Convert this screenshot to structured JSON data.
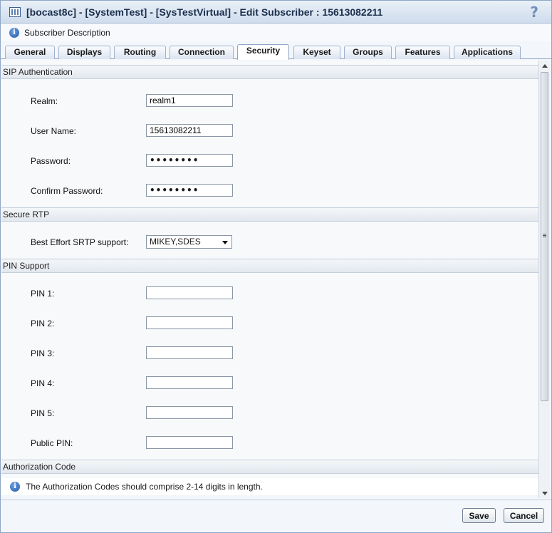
{
  "window": {
    "title": "[bocast8c] - [SystemTest] - [SysTestVirtual] - Edit Subscriber : 15613082211",
    "help_icon": "help-icon"
  },
  "description_bar": {
    "label": "Subscriber Description",
    "icon": "info-icon"
  },
  "tabs": [
    {
      "label": "General",
      "active": false
    },
    {
      "label": "Displays",
      "active": false
    },
    {
      "label": "Routing",
      "active": false
    },
    {
      "label": "Connection",
      "active": false
    },
    {
      "label": "Security",
      "active": true
    },
    {
      "label": "Keyset",
      "active": false
    },
    {
      "label": "Groups",
      "active": false
    },
    {
      "label": "Features",
      "active": false
    },
    {
      "label": "Applications",
      "active": false
    }
  ],
  "sip_auth": {
    "header": "SIP Authentication",
    "realm_label": "Realm:",
    "realm_value": "realm1",
    "username_label": "User Name:",
    "username_value": "15613082211",
    "password_label": "Password:",
    "password_masked": "••••••••",
    "confirm_label": "Confirm Password:",
    "confirm_masked": "••••••••"
  },
  "secure_rtp": {
    "header": "Secure RTP",
    "srtp_label": "Best Effort SRTP support:",
    "srtp_value": "MIKEY,SDES"
  },
  "pin_support": {
    "header": "PIN Support",
    "pin1_label": "PIN 1:",
    "pin2_label": "PIN 2:",
    "pin3_label": "PIN 3:",
    "pin4_label": "PIN 4:",
    "pin5_label": "PIN 5:",
    "public_pin_label": "Public PIN:",
    "pin1_value": "",
    "pin2_value": "",
    "pin3_value": "",
    "pin4_value": "",
    "pin5_value": "",
    "public_pin_value": ""
  },
  "authorization": {
    "header": "Authorization Code",
    "note": "The Authorization Codes should comprise 2-14 digits in length."
  },
  "footer": {
    "save_label": "Save",
    "cancel_label": "Cancel"
  }
}
